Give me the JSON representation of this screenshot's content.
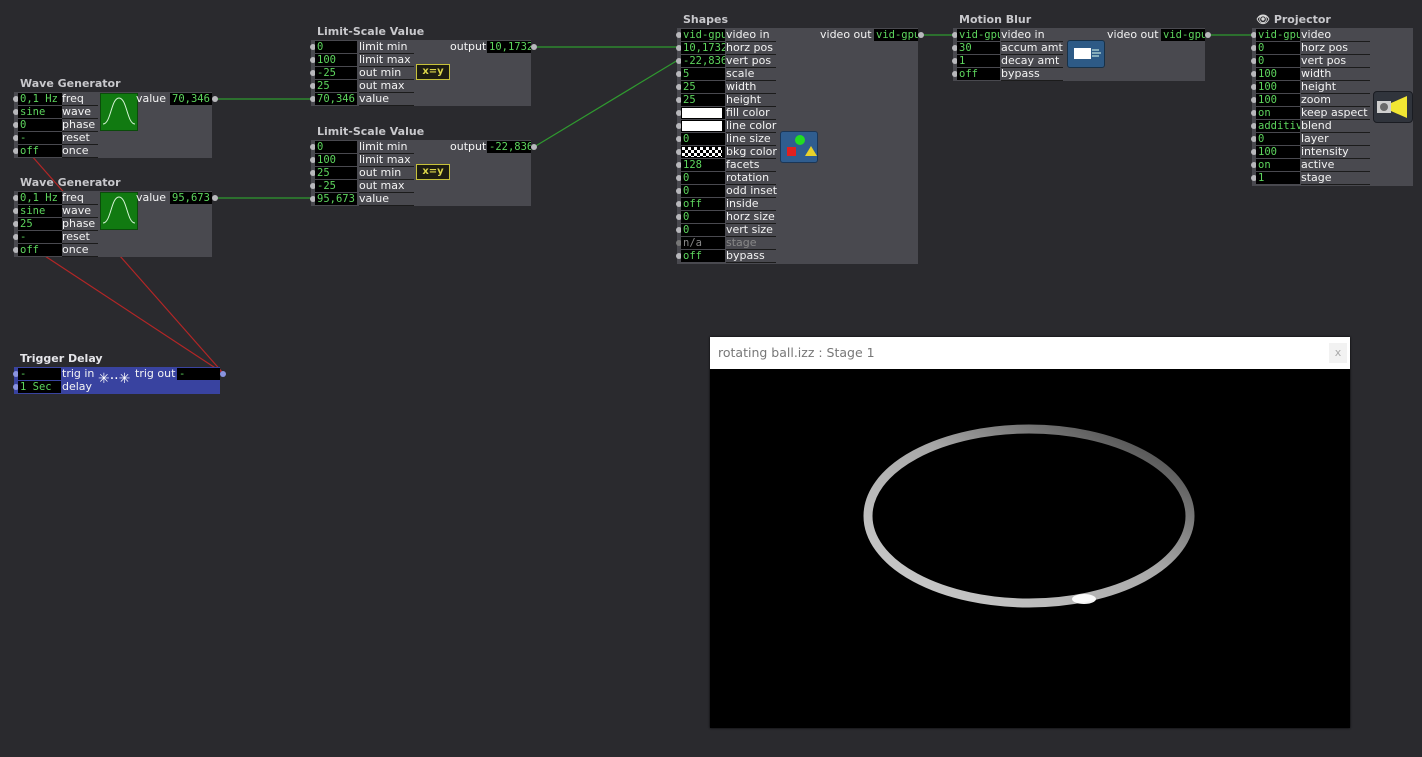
{
  "wave1": {
    "title": "Wave Generator",
    "output_label": "value",
    "output_value": "70,346",
    "rows": [
      {
        "value": "0,1 Hz",
        "label": "freq"
      },
      {
        "value": "sine",
        "label": "wave"
      },
      {
        "value": "0",
        "label": "phase"
      },
      {
        "value": "-",
        "label": "reset"
      },
      {
        "value": "off",
        "label": "once"
      }
    ]
  },
  "wave2": {
    "title": "Wave Generator",
    "output_label": "value",
    "output_value": "95,673",
    "rows": [
      {
        "value": "0,1 Hz",
        "label": "freq"
      },
      {
        "value": "sine",
        "label": "wave"
      },
      {
        "value": "25",
        "label": "phase"
      },
      {
        "value": "-",
        "label": "reset"
      },
      {
        "value": "off",
        "label": "once"
      }
    ]
  },
  "limit1": {
    "title": "Limit-Scale Value",
    "output_label": "output",
    "output_value": "10,1732",
    "badge": "x=y",
    "rows": [
      {
        "value": "0",
        "label": "limit min"
      },
      {
        "value": "100",
        "label": "limit max"
      },
      {
        "value": "-25",
        "label": "out min"
      },
      {
        "value": "25",
        "label": "out max"
      },
      {
        "value": "70,346",
        "label": "value"
      }
    ]
  },
  "limit2": {
    "title": "Limit-Scale Value",
    "output_label": "output",
    "output_value": "-22,836",
    "badge": "x=y",
    "rows": [
      {
        "value": "0",
        "label": "limit min"
      },
      {
        "value": "100",
        "label": "limit max"
      },
      {
        "value": "25",
        "label": "out min"
      },
      {
        "value": "-25",
        "label": "out max"
      },
      {
        "value": "95,673",
        "label": "value"
      }
    ]
  },
  "shapes": {
    "title": "Shapes",
    "output_label": "video out",
    "output_value": "vid-gpu",
    "rows": [
      {
        "value": "vid-gpu",
        "label": "video in"
      },
      {
        "value": "10,1732",
        "label": "horz pos"
      },
      {
        "value": "-22,836",
        "label": "vert pos"
      },
      {
        "value": "5",
        "label": "scale"
      },
      {
        "value": "25",
        "label": "width"
      },
      {
        "value": "25",
        "label": "height"
      },
      {
        "value": "",
        "label": "fill color"
      },
      {
        "value": "",
        "label": "line color"
      },
      {
        "value": "0",
        "label": "line size"
      },
      {
        "value": "",
        "label": "bkg color"
      },
      {
        "value": "128",
        "label": "facets"
      },
      {
        "value": "0",
        "label": "rotation"
      },
      {
        "value": "0",
        "label": "odd inset"
      },
      {
        "value": "off",
        "label": "inside"
      },
      {
        "value": "0",
        "label": "horz size"
      },
      {
        "value": "0",
        "label": "vert size"
      },
      {
        "value": "n/a",
        "label": "stage"
      },
      {
        "value": "off",
        "label": "bypass"
      }
    ]
  },
  "motion_blur": {
    "title": "Motion Blur",
    "output_label": "video out",
    "output_value": "vid-gpu",
    "rows": [
      {
        "value": "vid-gpu",
        "label": "video in"
      },
      {
        "value": "30",
        "label": "accum amt"
      },
      {
        "value": "1",
        "label": "decay amt"
      },
      {
        "value": "off",
        "label": "bypass"
      }
    ]
  },
  "projector": {
    "title": "Projector",
    "rows": [
      {
        "value": "vid-gpu",
        "label": "video"
      },
      {
        "value": "0",
        "label": "horz pos"
      },
      {
        "value": "0",
        "label": "vert pos"
      },
      {
        "value": "100",
        "label": "width"
      },
      {
        "value": "100",
        "label": "height"
      },
      {
        "value": "100",
        "label": "zoom"
      },
      {
        "value": "on",
        "label": "keep aspect"
      },
      {
        "value": "additive",
        "label": "blend"
      },
      {
        "value": "0",
        "label": "layer"
      },
      {
        "value": "100",
        "label": "intensity"
      },
      {
        "value": "on",
        "label": "active"
      },
      {
        "value": "1",
        "label": "stage"
      }
    ]
  },
  "trigger_delay": {
    "title": "Trigger Delay",
    "output_label": "trig out",
    "output_value": "-",
    "rows": [
      {
        "value": "-",
        "label": "trig in"
      },
      {
        "value": "1 Sec",
        "label": "delay"
      }
    ]
  },
  "stage_window": {
    "title": "rotating ball.izz : Stage 1",
    "close": "x"
  },
  "colors": {
    "background": "#2a2a2e",
    "actor": "#49494f",
    "value_text": "#5dd55d",
    "wire_green": "#2f9a2f",
    "wire_red": "#b42626",
    "trigger_delay": "#3943a0"
  }
}
